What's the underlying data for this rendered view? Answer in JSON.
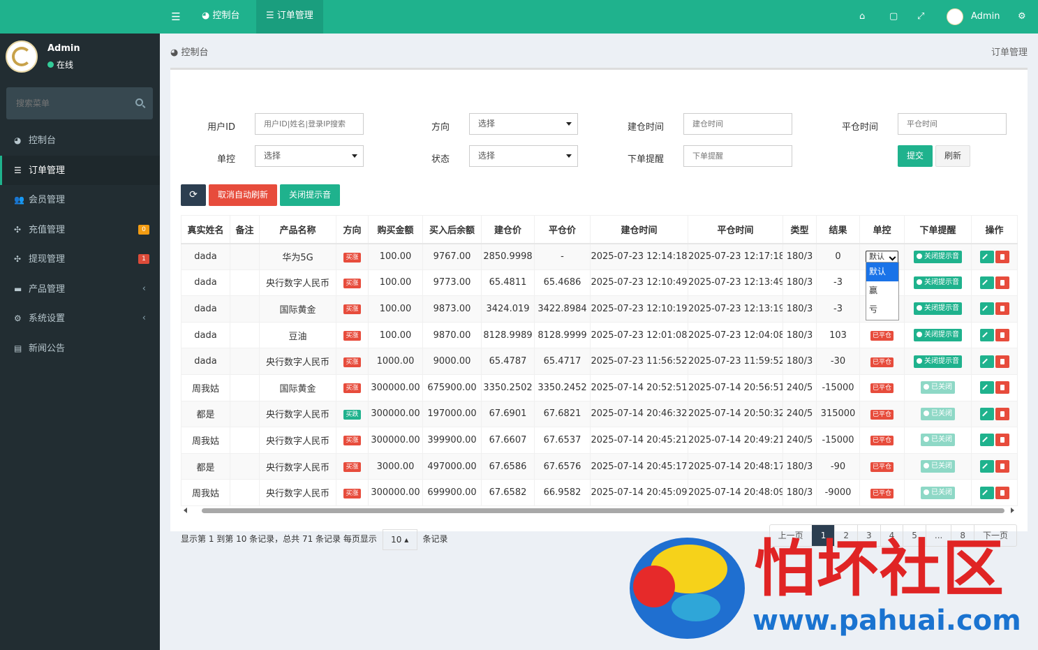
{
  "user": {
    "name": "Admin",
    "status": "在线"
  },
  "sidebar": {
    "search_placeholder": "搜索菜单",
    "items": [
      {
        "label": "控制台",
        "icon": "dashboard-icon"
      },
      {
        "label": "订单管理",
        "icon": "list-icon",
        "active": true
      },
      {
        "label": "会员管理",
        "icon": "users-icon"
      },
      {
        "label": "充值管理",
        "icon": "puzzle-icon",
        "badge": "0",
        "badge_color": "#f39c12"
      },
      {
        "label": "提现管理",
        "icon": "puzzle-icon",
        "badge": "1",
        "badge_color": "#dd4b39"
      },
      {
        "label": "产品管理",
        "icon": "briefcase-icon",
        "chevron": "‹"
      },
      {
        "label": "系统设置",
        "icon": "cogs-icon",
        "chevron": "‹"
      },
      {
        "label": "新闻公告",
        "icon": "newspaper-icon"
      }
    ]
  },
  "topbar": {
    "tabs": [
      {
        "label": "控制台"
      },
      {
        "label": "订单管理"
      }
    ],
    "user": "Admin"
  },
  "breadcrumb": {
    "left": "控制台",
    "right": "订单管理"
  },
  "filters": {
    "user_id_label": "用户ID",
    "user_id_placeholder": "用户ID|姓名|登录IP搜索",
    "direction_label": "方向",
    "direction_value": "选择",
    "open_time_label": "建仓时间",
    "open_time_placeholder": "建仓时间",
    "close_time_label": "平仓时间",
    "close_time_placeholder": "平仓时间",
    "control_label": "单控",
    "control_value": "选择",
    "status_label": "状态",
    "status_value": "选择",
    "remind_label": "下单提醒",
    "remind_placeholder": "下单提醒",
    "submit": "提交",
    "reset": "刷新"
  },
  "toolbar": {
    "cancel_refresh": "取消自动刷新",
    "close_sound": "关闭提示音"
  },
  "table": {
    "headers": [
      "真实姓名",
      "备注",
      "产品名称",
      "方向",
      "购买金额",
      "买入后余额",
      "建仓价",
      "平仓价",
      "建仓时间",
      "平仓时间",
      "类型",
      "结果",
      "单控",
      "下单提醒",
      "操作"
    ],
    "rows": [
      {
        "name": "dada",
        "note": "",
        "product": "华为5G",
        "dir": "买涨",
        "dir_color": "#e74c3c",
        "amount": "100.00",
        "balance": "9767.00",
        "open": "2850.9998",
        "close": "-",
        "open_time": "2025-07-23 12:14:18",
        "close_time": "2025-07-23 12:17:18",
        "type": "180/3",
        "result": "0",
        "control": "select",
        "remind": "关闭提示音",
        "remind_on": true
      },
      {
        "name": "dada",
        "note": "",
        "product": "央行数字人民币",
        "dir": "买涨",
        "dir_color": "#e74c3c",
        "amount": "100.00",
        "balance": "9773.00",
        "open": "65.4811",
        "close": "65.4686",
        "open_time": "2025-07-23 12:10:49",
        "close_time": "2025-07-23 12:13:49",
        "type": "180/3",
        "result": "-3",
        "control": "none",
        "remind": "关闭提示音",
        "remind_on": true
      },
      {
        "name": "dada",
        "note": "",
        "product": "国际黄金",
        "dir": "买涨",
        "dir_color": "#e74c3c",
        "amount": "100.00",
        "balance": "9873.00",
        "open": "3424.019",
        "close": "3422.8984",
        "open_time": "2025-07-23 12:10:19",
        "close_time": "2025-07-23 12:13:19",
        "type": "180/3",
        "result": "-3",
        "control": "none",
        "remind": "关闭提示音",
        "remind_on": true
      },
      {
        "name": "dada",
        "note": "",
        "product": "豆油",
        "dir": "买涨",
        "dir_color": "#e74c3c",
        "amount": "100.00",
        "balance": "9870.00",
        "open": "8128.9989",
        "close": "8128.9999",
        "open_time": "2025-07-23 12:01:08",
        "close_time": "2025-07-23 12:04:08",
        "type": "180/3",
        "result": "103",
        "control": "已平仓",
        "remind": "关闭提示音",
        "remind_on": true
      },
      {
        "name": "dada",
        "note": "",
        "product": "央行数字人民币",
        "dir": "买涨",
        "dir_color": "#e74c3c",
        "amount": "1000.00",
        "balance": "9000.00",
        "open": "65.4787",
        "close": "65.4717",
        "open_time": "2025-07-23 11:56:52",
        "close_time": "2025-07-23 11:59:52",
        "type": "180/3",
        "result": "-30",
        "control": "已平仓",
        "remind": "关闭提示音",
        "remind_on": true
      },
      {
        "name": "周我姑",
        "note": "",
        "product": "国际黄金",
        "dir": "买涨",
        "dir_color": "#e74c3c",
        "amount": "300000.00",
        "balance": "675900.00",
        "open": "3350.2502",
        "close": "3350.2452",
        "open_time": "2025-07-14 20:52:51",
        "close_time": "2025-07-14 20:56:51",
        "type": "240/5",
        "result": "-15000",
        "control": "已平仓",
        "remind": "已关闭",
        "remind_on": false
      },
      {
        "name": "都是",
        "note": "",
        "product": "央行数字人民币",
        "dir": "买跌",
        "dir_color": "#1fb28d",
        "amount": "300000.00",
        "balance": "197000.00",
        "open": "67.6901",
        "close": "67.6821",
        "open_time": "2025-07-14 20:46:32",
        "close_time": "2025-07-14 20:50:32",
        "type": "240/5",
        "result": "315000",
        "control": "已平仓",
        "remind": "已关闭",
        "remind_on": false
      },
      {
        "name": "周我姑",
        "note": "",
        "product": "央行数字人民币",
        "dir": "买涨",
        "dir_color": "#e74c3c",
        "amount": "300000.00",
        "balance": "399900.00",
        "open": "67.6607",
        "close": "67.6537",
        "open_time": "2025-07-14 20:45:21",
        "close_time": "2025-07-14 20:49:21",
        "type": "240/5",
        "result": "-15000",
        "control": "已平仓",
        "remind": "已关闭",
        "remind_on": false
      },
      {
        "name": "都是",
        "note": "",
        "product": "央行数字人民币",
        "dir": "买涨",
        "dir_color": "#e74c3c",
        "amount": "3000.00",
        "balance": "497000.00",
        "open": "67.6586",
        "close": "67.6576",
        "open_time": "2025-07-14 20:45:17",
        "close_time": "2025-07-14 20:48:17",
        "type": "180/3",
        "result": "-90",
        "control": "已平仓",
        "remind": "已关闭",
        "remind_on": false
      },
      {
        "name": "周我姑",
        "note": "",
        "product": "央行数字人民币",
        "dir": "买涨",
        "dir_color": "#e74c3c",
        "amount": "300000.00",
        "balance": "699900.00",
        "open": "67.6582",
        "close": "66.9582",
        "open_time": "2025-07-14 20:45:09",
        "close_time": "2025-07-14 20:48:09",
        "type": "180/3",
        "result": "-9000",
        "control": "已平仓",
        "remind": "已关闭",
        "remind_on": false
      }
    ]
  },
  "control_select": {
    "value": "默认",
    "options": [
      "默认",
      "赢",
      "亏"
    ]
  },
  "pagination": {
    "info_prefix": "显示第 1 到第 10 条记录，总共 71 条记录 每页显示",
    "page_size": "10",
    "info_suffix": "条记录",
    "prev": "上一页",
    "pages": [
      "1",
      "2",
      "3",
      "4",
      "5",
      "...",
      "8"
    ],
    "current": "1",
    "next": "下一页"
  },
  "watermark": {
    "title": "怕坏社区",
    "url": "www.pahuai.com"
  }
}
